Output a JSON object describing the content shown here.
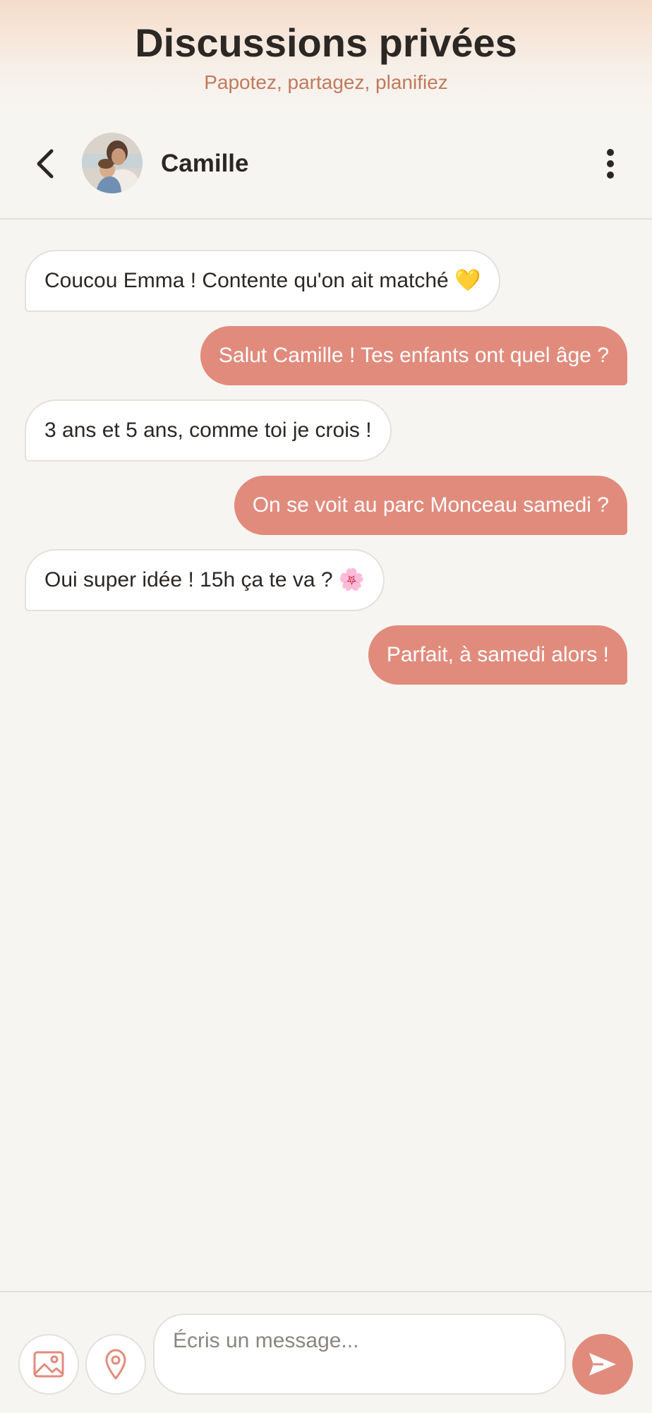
{
  "header": {
    "title": "Discussions privées",
    "subtitle": "Papotez, partagez, planifiez"
  },
  "chat_header": {
    "back_icon": "chevron-left-icon",
    "contact_name": "Camille",
    "avatar": "avatar-photo-mother-and-child",
    "more_icon": "more-vertical-icon"
  },
  "messages": [
    {
      "direction": "incoming",
      "text": "Coucou Emma ! Contente qu'on ait matché 💛"
    },
    {
      "direction": "outgoing",
      "text": "Salut Camille ! Tes enfants ont quel âge ?"
    },
    {
      "direction": "incoming",
      "text": "3 ans et 5 ans, comme toi je crois !"
    },
    {
      "direction": "outgoing",
      "text": "On se voit au parc Monceau samedi ?"
    },
    {
      "direction": "incoming",
      "text": "Oui super idée ! 15h ça te va ? 🌸"
    },
    {
      "direction": "outgoing",
      "text": "Parfait, à samedi alors !"
    }
  ],
  "composer": {
    "placeholder": "Écris un message...",
    "value": "",
    "image_icon": "image-icon",
    "location_icon": "location-pin-icon",
    "send_icon": "send-icon"
  },
  "colors": {
    "accent": "#e18b7c",
    "subtitle": "#c07a5c",
    "background": "#f7f5f2",
    "incoming_bubble": "#ffffff",
    "text": "#2b2724"
  }
}
